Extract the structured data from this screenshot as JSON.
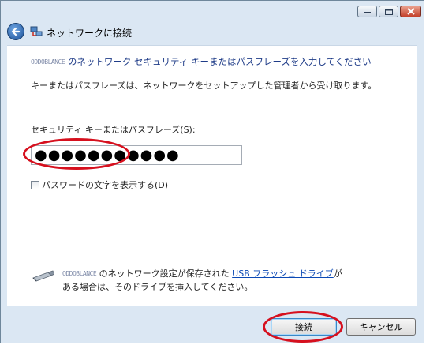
{
  "window": {
    "title": "ネットワークに接続"
  },
  "content": {
    "network_name_blurred": "ODDOBLANCE",
    "heading_suffix": " のネットワーク セキュリティ キーまたはパスフレーズを入力してください",
    "info": "キーまたはパスフレーズは、ネットワークをセットアップした管理者から受け取ります。",
    "key_label": "セキュリティ キーまたはパスフレーズ(S):",
    "key_value": "●●●●●●●●●●●",
    "show_chars_label": "パスワードの文字を表示する(D)",
    "usb_name_blurred": "ODDOBLANCE",
    "usb_text_before_link": " のネットワーク設定が保存された ",
    "usb_link": "USB フラッシュ ドライブ",
    "usb_text_after_link": "が",
    "usb_line2": "ある場合は、そのドライブを挿入してください。"
  },
  "buttons": {
    "connect": "接続",
    "cancel": "キャンセル"
  },
  "colors": {
    "heading": "#1f3c88",
    "link": "#0b49b5",
    "annotation_ring": "#d6101e"
  },
  "icons": {
    "minimize": "minimize-icon",
    "maximize": "maximize-icon",
    "close": "close-icon",
    "back": "back-arrow-icon",
    "network": "network-icon",
    "usb": "usb-drive-icon"
  }
}
